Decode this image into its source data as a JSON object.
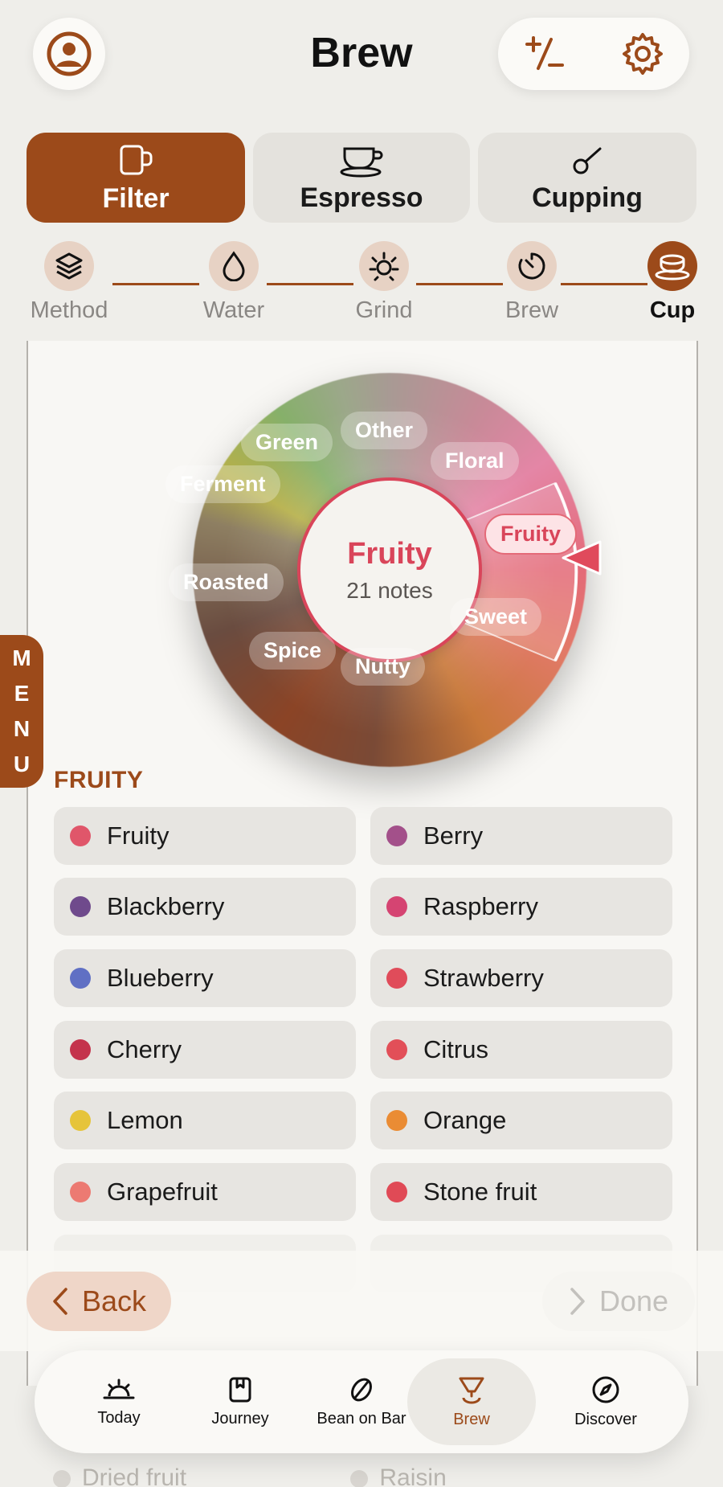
{
  "header": {
    "title": "Brew",
    "avatar_icon": "person-circle-icon",
    "tools": [
      {
        "icon": "plus-minus-icon"
      },
      {
        "icon": "gear-icon"
      }
    ]
  },
  "brew_types": [
    {
      "label": "Filter",
      "icon": "mug-icon",
      "active": true
    },
    {
      "label": "Espresso",
      "icon": "espresso-cup-icon",
      "active": false
    },
    {
      "label": "Cupping",
      "icon": "spoon-icon",
      "active": false
    }
  ],
  "steps": [
    {
      "label": "Method",
      "icon": "layers-icon"
    },
    {
      "label": "Water",
      "icon": "droplet-icon"
    },
    {
      "label": "Grind",
      "icon": "grinder-icon"
    },
    {
      "label": "Brew",
      "icon": "timer-icon"
    },
    {
      "label": "Cup",
      "icon": "cup-icon",
      "active": true
    }
  ],
  "wheel": {
    "center_title": "Fruity",
    "center_subtitle": "21 notes",
    "segments": [
      "Other",
      "Floral",
      "Fruity",
      "Sweet",
      "Nutty",
      "Spice",
      "Roasted",
      "Ferment",
      "Green"
    ],
    "selected": "Fruity"
  },
  "section_title": "FRUITY",
  "notes": [
    {
      "label": "Fruity",
      "color": "#e0566a"
    },
    {
      "label": "Berry",
      "color": "#a3508a"
    },
    {
      "label": "Blackberry",
      "color": "#6f4a8c"
    },
    {
      "label": "Raspberry",
      "color": "#d54472"
    },
    {
      "label": "Blueberry",
      "color": "#6070c4"
    },
    {
      "label": "Strawberry",
      "color": "#e04c5a"
    },
    {
      "label": "Cherry",
      "color": "#c4334c"
    },
    {
      "label": "Citrus",
      "color": "#e24f58"
    },
    {
      "label": "Lemon",
      "color": "#e6c43a"
    },
    {
      "label": "Orange",
      "color": "#ea8c34"
    },
    {
      "label": "Grapefruit",
      "color": "#ec7a72"
    },
    {
      "label": "Stone fruit",
      "color": "#e04a56"
    }
  ],
  "faded_notes": [
    "Dried fruit",
    "Raisin"
  ],
  "menu_label": [
    "M",
    "E",
    "N",
    "U"
  ],
  "actions": {
    "back_label": "Back",
    "done_label": "Done"
  },
  "tabbar": [
    {
      "label": "Today",
      "icon": "sunrise-icon"
    },
    {
      "label": "Journey",
      "icon": "notebook-icon"
    },
    {
      "label": "Bean on Bar",
      "icon": "coffee-bean-icon"
    },
    {
      "label": "Brew",
      "icon": "dripper-icon",
      "active": true
    },
    {
      "label": "Discover",
      "icon": "compass-icon"
    }
  ]
}
